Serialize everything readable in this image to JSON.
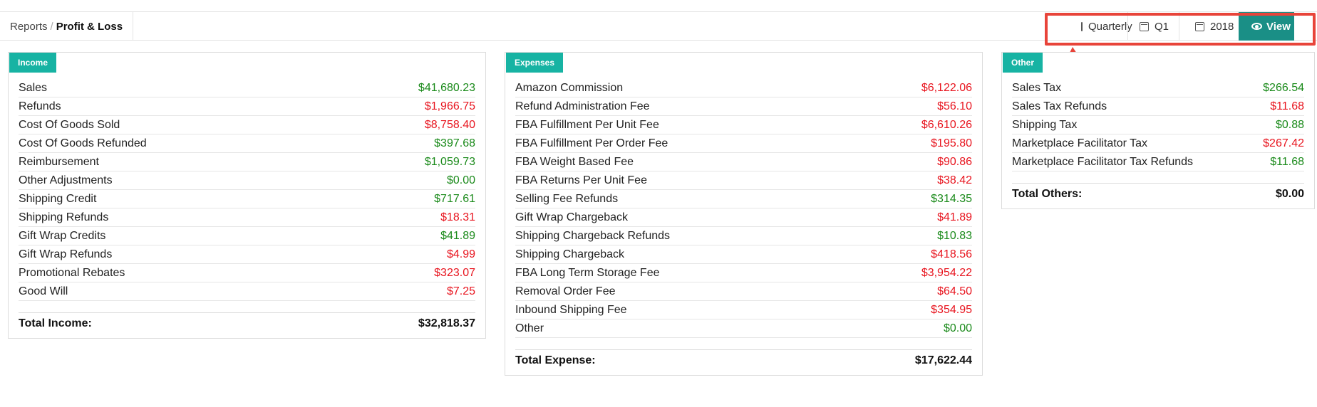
{
  "breadcrumb": {
    "parent": "Reports",
    "separator": "/",
    "current": "Profit & Loss"
  },
  "filters": {
    "period": "Quarterly",
    "quarter": "Q1",
    "year": "2018",
    "view_label": "View"
  },
  "colors": {
    "accent": "#17b3a3",
    "view_button": "#1a8f86",
    "positive": "#1a8a1a",
    "negative": "#e8141e",
    "highlight": "#e8443a"
  },
  "income": {
    "tag": "Income",
    "rows": [
      {
        "label": "Sales",
        "value": "$41,680.23",
        "sign": "pos"
      },
      {
        "label": "Refunds",
        "value": "$1,966.75",
        "sign": "neg"
      },
      {
        "label": "Cost Of Goods Sold",
        "value": "$8,758.40",
        "sign": "neg"
      },
      {
        "label": "Cost Of Goods Refunded",
        "value": "$397.68",
        "sign": "pos"
      },
      {
        "label": "Reimbursement",
        "value": "$1,059.73",
        "sign": "pos"
      },
      {
        "label": "Other Adjustments",
        "value": "$0.00",
        "sign": "pos"
      },
      {
        "label": "Shipping Credit",
        "value": "$717.61",
        "sign": "pos"
      },
      {
        "label": "Shipping Refunds",
        "value": "$18.31",
        "sign": "neg"
      },
      {
        "label": "Gift Wrap Credits",
        "value": "$41.89",
        "sign": "pos"
      },
      {
        "label": "Gift Wrap Refunds",
        "value": "$4.99",
        "sign": "neg"
      },
      {
        "label": "Promotional Rebates",
        "value": "$323.07",
        "sign": "neg"
      },
      {
        "label": "Good Will",
        "value": "$7.25",
        "sign": "neg"
      }
    ],
    "total_label": "Total Income:",
    "total_value": "$32,818.37"
  },
  "expenses": {
    "tag": "Expenses",
    "rows": [
      {
        "label": "Amazon Commission",
        "value": "$6,122.06",
        "sign": "neg"
      },
      {
        "label": "Refund Administration Fee",
        "value": "$56.10",
        "sign": "neg"
      },
      {
        "label": "FBA Fulfillment Per Unit Fee",
        "value": "$6,610.26",
        "sign": "neg"
      },
      {
        "label": "FBA Fulfillment Per Order Fee",
        "value": "$195.80",
        "sign": "neg"
      },
      {
        "label": "FBA Weight Based Fee",
        "value": "$90.86",
        "sign": "neg"
      },
      {
        "label": "FBA Returns Per Unit Fee",
        "value": "$38.42",
        "sign": "neg"
      },
      {
        "label": "Selling Fee Refunds",
        "value": "$314.35",
        "sign": "pos"
      },
      {
        "label": "Gift Wrap Chargeback",
        "value": "$41.89",
        "sign": "neg"
      },
      {
        "label": "Shipping Chargeback Refunds",
        "value": "$10.83",
        "sign": "pos"
      },
      {
        "label": "Shipping Chargeback",
        "value": "$418.56",
        "sign": "neg"
      },
      {
        "label": "FBA Long Term Storage Fee",
        "value": "$3,954.22",
        "sign": "neg"
      },
      {
        "label": "Removal Order Fee",
        "value": "$64.50",
        "sign": "neg"
      },
      {
        "label": "Inbound Shipping Fee",
        "value": "$354.95",
        "sign": "neg"
      },
      {
        "label": "Other",
        "value": "$0.00",
        "sign": "pos"
      }
    ],
    "total_label": "Total Expense:",
    "total_value": "$17,622.44"
  },
  "other": {
    "tag": "Other",
    "rows": [
      {
        "label": "Sales Tax",
        "value": "$266.54",
        "sign": "pos"
      },
      {
        "label": "Sales Tax Refunds",
        "value": "$11.68",
        "sign": "neg"
      },
      {
        "label": "Shipping Tax",
        "value": "$0.88",
        "sign": "pos"
      },
      {
        "label": "Marketplace Facilitator Tax",
        "value": "$267.42",
        "sign": "neg"
      },
      {
        "label": "Marketplace Facilitator Tax Refunds",
        "value": "$11.68",
        "sign": "pos"
      }
    ],
    "total_label": "Total Others:",
    "total_value": "$0.00"
  }
}
